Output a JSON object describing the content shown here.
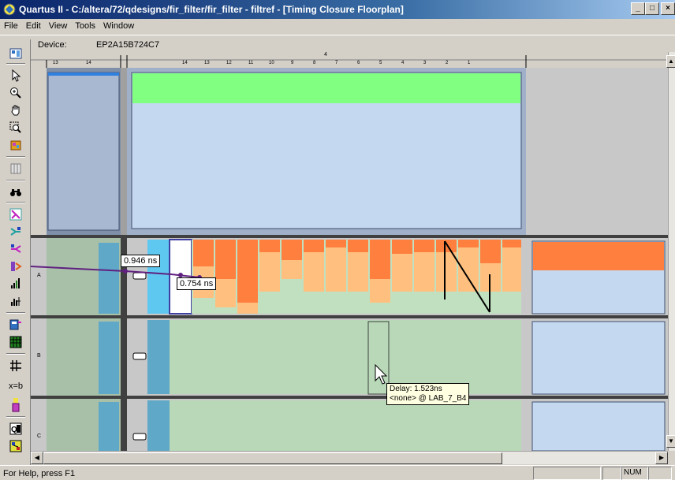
{
  "window": {
    "title": "Quartus II - C:/altera/72/qdesigns/fir_filter/fir_filter - filtref - [Timing Closure Floorplan]",
    "minimize": "_",
    "restore": "□",
    "close": "×"
  },
  "menu": {
    "items": [
      "File",
      "Edit",
      "View",
      "Tools",
      "Window"
    ]
  },
  "device": {
    "label": "Device:",
    "value": "EP2A15B724C7"
  },
  "toolbar": {
    "icons": [
      "floorplan-view-icon",
      "pointer-icon",
      "zoom-icon",
      "hand-icon",
      "zoom-region-icon",
      "assign-icon",
      "grid-icon",
      "find-icon",
      "show-routing-icon",
      "show-fanin-icon",
      "show-fanout-icon",
      "show-paths-icon",
      "show-critical-icon",
      "show-delay-icon",
      "show-logic-icon",
      "show-lab-icon",
      "show-pins-icon",
      "equation-icon",
      "color-legend-icon",
      "show-regions-icon",
      "show-nodes-icon"
    ],
    "equation_label": "x=b"
  },
  "ruler": {
    "top_marker": "4",
    "ticks": [
      "13",
      "14",
      "14",
      "13",
      "12",
      "11",
      "10",
      "9",
      "8",
      "7",
      "6",
      "5",
      "4",
      "3",
      "2",
      "1"
    ]
  },
  "rows": {
    "labels": [
      "A",
      "B",
      "C"
    ]
  },
  "delays": {
    "label1": "0.946 ns",
    "label2": "0.754 ns"
  },
  "tooltip": {
    "line1": "Delay: 1.523ns",
    "line2": "<none> @ LAB_7_B4"
  },
  "status": {
    "help": "For Help, press F1",
    "num": "NUM"
  },
  "colors": {
    "green": "#80ff80",
    "lightblue": "#c4d8f0",
    "orange": "#ff7f3f",
    "peach": "#ffc07f",
    "mint": "#b8d8b8",
    "teal": "#5fa8c8",
    "path": "#602080"
  }
}
